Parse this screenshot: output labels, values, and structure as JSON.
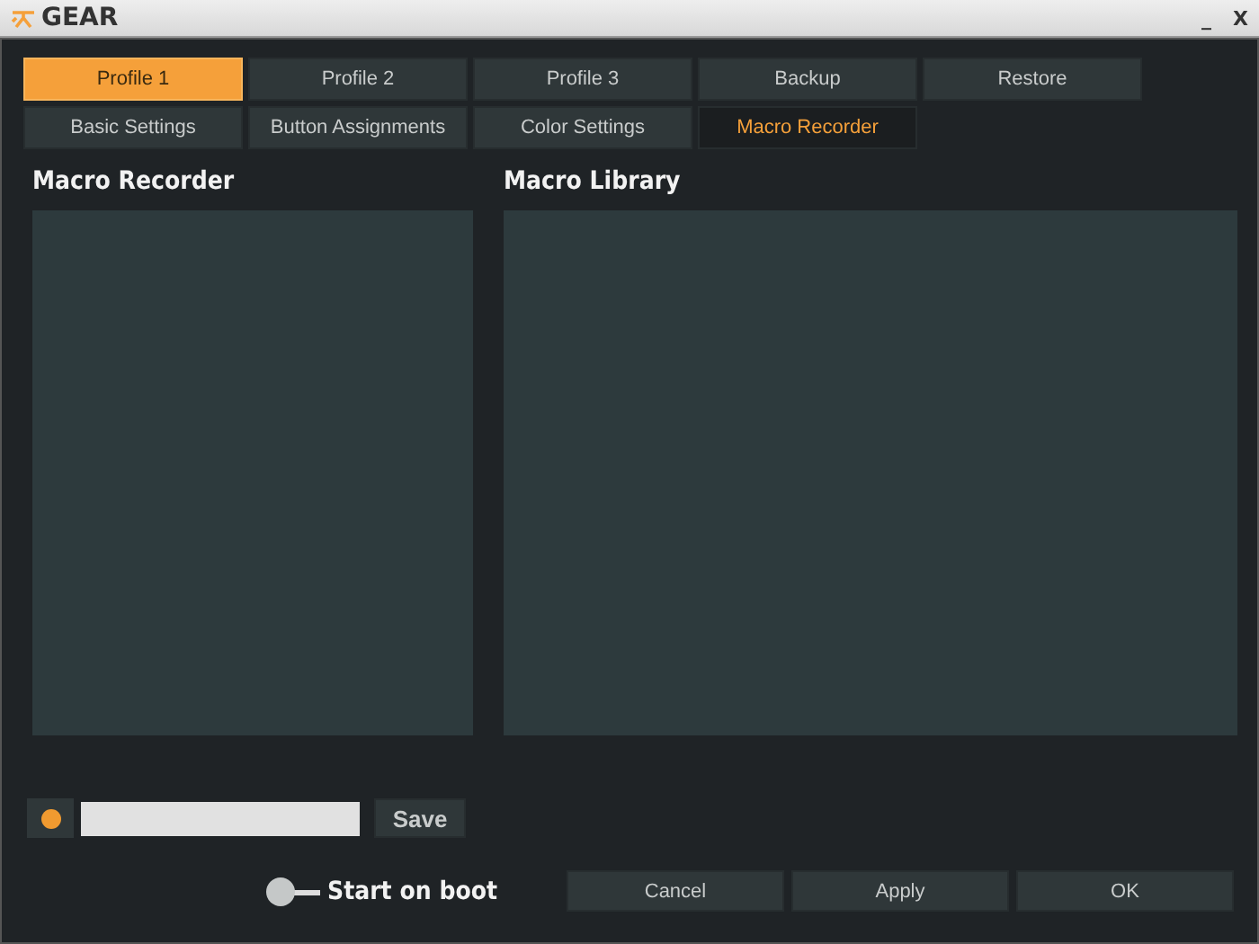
{
  "window": {
    "title": "GEAR",
    "controls": [
      "_",
      "X"
    ]
  },
  "profile_bar": [
    {
      "label": "Profile 1",
      "kind": "profile",
      "selected": true
    },
    {
      "label": "Profile 2",
      "kind": "profile",
      "selected": false
    },
    {
      "label": "Profile 3",
      "kind": "profile",
      "selected": false
    },
    {
      "label": "Backup",
      "kind": "action"
    },
    {
      "label": "Restore",
      "kind": "action"
    }
  ],
  "tabs": [
    {
      "label": "Basic Settings",
      "selected": false
    },
    {
      "label": "Button Assignments",
      "selected": false
    },
    {
      "label": "Color Settings",
      "selected": false
    },
    {
      "label": "Macro Recorder",
      "selected": true
    }
  ],
  "macro_recorder": {
    "heading": "Macro Recorder",
    "save_button": "Save"
  },
  "macro_library": {
    "heading": "Macro Library"
  },
  "start_on_boot": {
    "label": "Start on boot",
    "on": false
  },
  "buttons": [
    "Cancel",
    "Apply",
    "OK"
  ]
}
